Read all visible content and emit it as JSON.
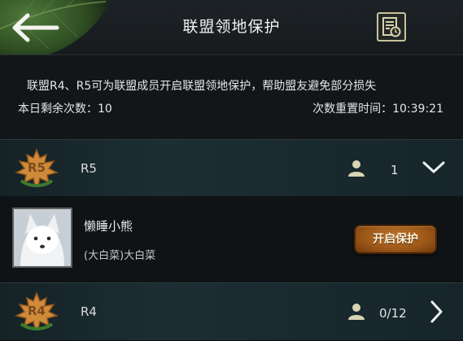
{
  "header": {
    "title": "联盟领地保护"
  },
  "info": {
    "description": "联盟R4、R5可为联盟成员开启联盟领地保护，帮助盟友避免部分损失",
    "remaining_label": "本日剩余次数：",
    "remaining_value": "10",
    "reset_label": "次数重置时间：",
    "reset_value": "10:39:21"
  },
  "ranks": [
    {
      "badge": "R5",
      "name": "R5",
      "count": "1",
      "expanded": true
    },
    {
      "badge": "R4",
      "name": "R4",
      "count": "0/12",
      "expanded": false
    }
  ],
  "member": {
    "name": "懒睡小熊",
    "subtitle": "(大白菜)大白菜",
    "button_label": "开启保护"
  },
  "icons": {
    "back": "back-arrow-icon",
    "log": "log-clock-icon",
    "info": "info-icon",
    "badge": "maple-leaf-badge-icon",
    "person": "person-icon",
    "expand": "chevron-down-icon",
    "collapse": "chevron-right-icon"
  },
  "colors": {
    "accent_button": "#9a5517",
    "badge_leaf": "#d08a3a",
    "header_icon_border": "#c9c29b"
  }
}
